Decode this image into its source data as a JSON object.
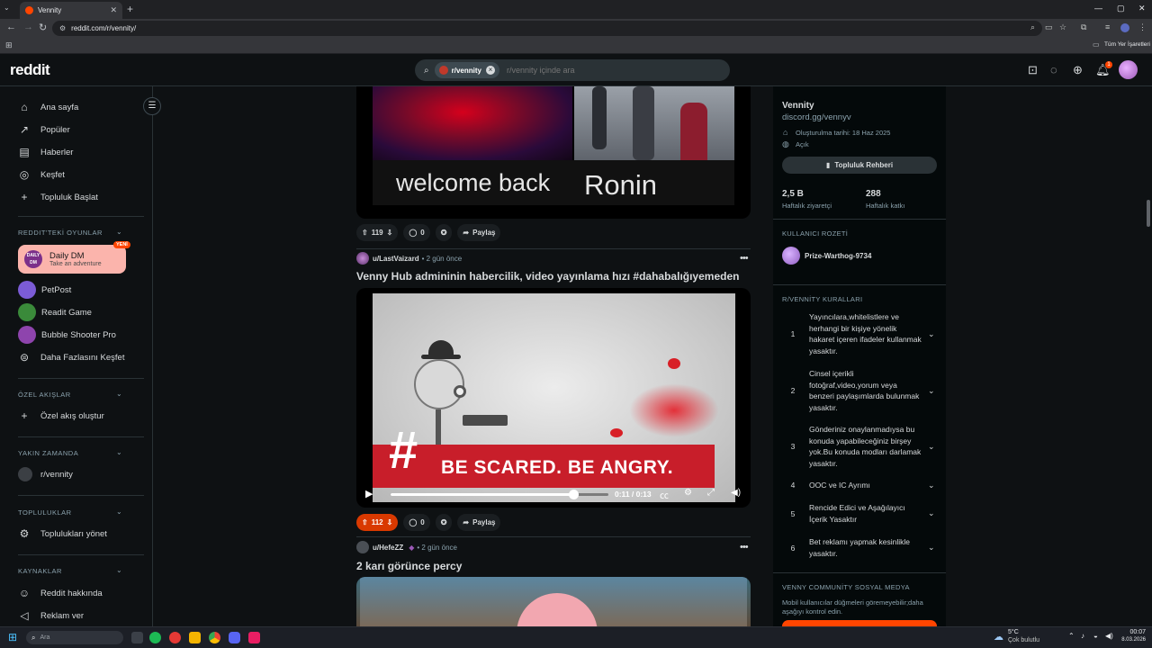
{
  "browser": {
    "tab_title": "Vennity",
    "url": "reddit.com/r/vennity/",
    "bookmarks_label": "Tüm Yer İşaretleri"
  },
  "header": {
    "logo": "reddit",
    "search_chip": "r/vennity",
    "search_placeholder": "r/vennity içinde ara",
    "notif_count": "1"
  },
  "sidebar": {
    "main": [
      {
        "label": "Ana sayfa",
        "icon": "home-icon",
        "glyph": "⌂"
      },
      {
        "label": "Popüler",
        "icon": "popular-icon",
        "glyph": "↗"
      },
      {
        "label": "Haberler",
        "icon": "news-icon",
        "glyph": "▤"
      },
      {
        "label": "Keşfet",
        "icon": "explore-icon",
        "glyph": "◎"
      },
      {
        "label": "Topluluk Başlat",
        "icon": "plus-icon",
        "glyph": "+"
      }
    ],
    "games_header": "REDDIT'TEKİ OYUNLAR",
    "daily_dm": {
      "title": "Daily DM",
      "subtitle": "Take an adventure",
      "badge": "YENİ",
      "avatar_text": "DAILY DM"
    },
    "games": [
      {
        "label": "PetPost",
        "color": "#7b5cd6"
      },
      {
        "label": "Readit Game",
        "color": "#3a8a3a"
      },
      {
        "label": "Bubble Shooter Pro",
        "color": "#8e44ad"
      }
    ],
    "more_games": "Daha Fazlasını Keşfet",
    "custom_header": "ÖZEL AKIŞLAR",
    "custom_create": "Özel akış oluştur",
    "recent_header": "YAKIN ZAMANDA",
    "recent_item": "r/vennity",
    "communities_header": "TOPLULUKLAR",
    "manage_communities": "Toplulukları yönet",
    "resources_header": "KAYNAKLAR",
    "about": "Reddit hakkında",
    "advertise": "Reklam ver"
  },
  "feed": {
    "post0": {
      "caption_left": "welcome back",
      "caption_right": "Ronin",
      "votes": "119",
      "comments": "0",
      "share": "Paylaş"
    },
    "post1": {
      "user": "u/LastVaizard",
      "time": "• 2 gün önce",
      "title": "Venny Hub admininin habercilik, video yayınlama hızı #dahabalığıyemeden",
      "video_banner": "BE SCARED. BE ANGRY.",
      "video_time": "0:11 / 0:13",
      "progress": 0.84,
      "votes": "112",
      "comments": "0",
      "share": "Paylaş"
    },
    "post2": {
      "user": "u/HefeZZ",
      "time": "• 2 gün önce",
      "title": "2 karı görünce percy"
    }
  },
  "community": {
    "name": "Vennity",
    "link": "discord.gg/vennyv",
    "created": "Oluşturulma tarihi: 18 Haz 2025",
    "visibility": "Açık",
    "guide_button": "Topluluk Rehberi",
    "visitors": "2,5 B",
    "visitors_label": "Haftalık ziyaretçi",
    "contributions": "288",
    "contributions_label": "Haftalık katkı",
    "badge_header": "KULLANICI ROZETİ",
    "badge_user": "Prize-Warthog-9734",
    "rules_header": "R/VENNİTY KURALLARI",
    "rules": [
      {
        "n": "1",
        "text": "Yayıncılara,whitelistlere ve herhangi bir kişiye yönelik hakaret içeren ifadeler kullanmak yasaktır."
      },
      {
        "n": "2",
        "text": "Cinsel içerikli fotoğraf,video,yorum veya benzeri paylaşımlarda bulunmak yasaktır."
      },
      {
        "n": "3",
        "text": "Gönderiniz onaylanmadıysa bu konuda yapabileceğiniz birşey yok.Bu konuda modları darlamak yasaktır."
      },
      {
        "n": "4",
        "text": "OOC ve IC Ayrımı"
      },
      {
        "n": "5",
        "text": "Rencide Edici ve Aşağılayıcı İçerik Yasaktır"
      },
      {
        "n": "6",
        "text": "Bet reklamı yapmak kesinlikle yasaktır."
      }
    ],
    "social_header": "VENNY COMMUNİTY SOSYAL MEDYA",
    "social_note": "Mobil kullanıcılar düğmeleri göremeyebilir;daha aşağıyı kontrol edin."
  },
  "taskbar": {
    "search_placeholder": "Ara",
    "weather_temp": "5°C",
    "weather_desc": "Çok bulutlu",
    "time": "00:07",
    "date": "8.03.2026"
  }
}
